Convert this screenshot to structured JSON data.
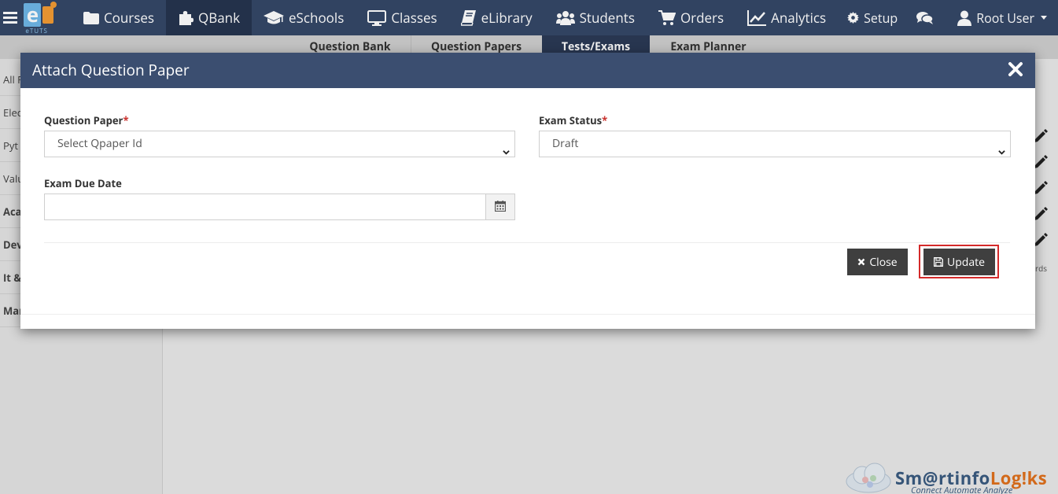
{
  "nav": {
    "logo_tag": "eTUTS",
    "items": [
      {
        "label": "Courses",
        "icon": "folder-icon"
      },
      {
        "label": "QBank",
        "icon": "puzzle-icon"
      },
      {
        "label": "eSchools",
        "icon": "graduation-cap-icon"
      },
      {
        "label": "Classes",
        "icon": "monitor-icon"
      },
      {
        "label": "eLibrary",
        "icon": "book-icon"
      },
      {
        "label": "Students",
        "icon": "users-icon"
      },
      {
        "label": "Orders",
        "icon": "cart-icon"
      },
      {
        "label": "Analytics",
        "icon": "line-chart-icon"
      }
    ],
    "active": "QBank",
    "setup": "Setup",
    "user": "Root User"
  },
  "subnav": {
    "tabs": [
      "Question Bank",
      "Question Papers",
      "Tests/Exams",
      "Exam Planner"
    ],
    "active": "Tests/Exams"
  },
  "sidebar": {
    "items": [
      "All F",
      "Elec",
      "Pyt",
      "Valu",
      "Aca",
      "Dev",
      "It &",
      "Mar"
    ]
  },
  "background": {
    "records_text": "ords"
  },
  "modal": {
    "title": "Attach Question Paper",
    "question_paper_label": "Question Paper",
    "question_paper_value": "Select Qpaper Id",
    "exam_status_label": "Exam Status",
    "exam_status_value": "Draft",
    "due_date_label": "Exam Due Date",
    "due_date_value": "",
    "required_mark": "*",
    "close_label": "Close",
    "update_label": "Update"
  },
  "watermark": {
    "brand_pre": "Sm@rtinfo",
    "brand_post": "Log!ks",
    "slogan": "Connect Automate Analyze"
  },
  "colors": {
    "navbar": "#354868",
    "modal_header": "#3b4e70",
    "button": "#3f3f3f",
    "highlight": "#d42a2a",
    "required": "#c9302c"
  }
}
